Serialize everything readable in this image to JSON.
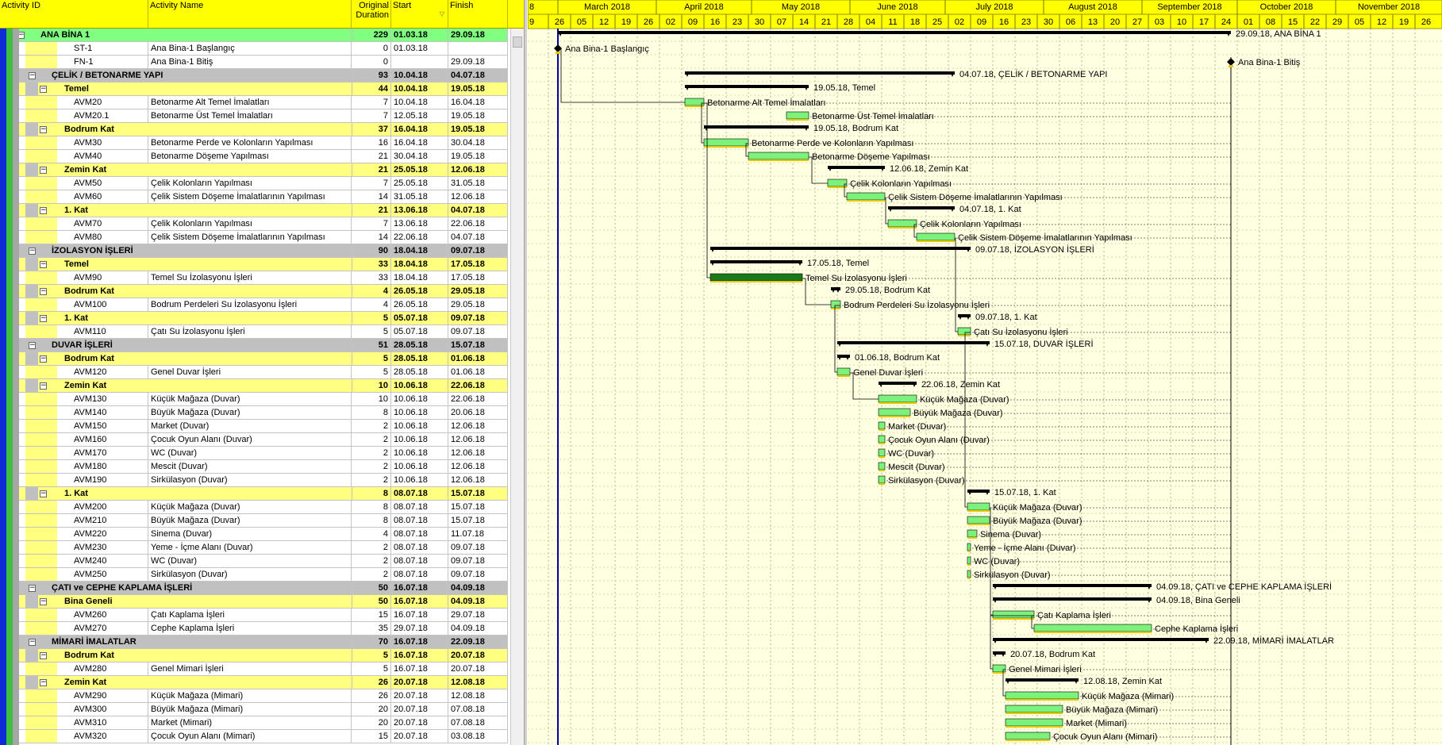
{
  "columns": {
    "activity_id": "Activity ID",
    "activity_name": "Activity Name",
    "duration_line1": "Original",
    "duration_line2": "Duration",
    "start": "Start",
    "finish": "Finish"
  },
  "timeline": {
    "months": [
      "8",
      "March 2018",
      "April 2018",
      "May 2018",
      "June 2018",
      "July 2018",
      "August 2018",
      "September 2018",
      "October 2018",
      "November 2018"
    ],
    "weeks": [
      "9",
      "26",
      "05",
      "12",
      "19",
      "26",
      "02",
      "09",
      "16",
      "23",
      "30",
      "07",
      "14",
      "21",
      "28",
      "04",
      "11",
      "18",
      "25",
      "02",
      "09",
      "16",
      "23",
      "30",
      "06",
      "13",
      "20",
      "27",
      "03",
      "10",
      "17",
      "24",
      "01",
      "08",
      "15",
      "22",
      "29",
      "05",
      "12",
      "19",
      "26"
    ]
  },
  "colors": {
    "row_level0": "#80ff80",
    "row_level1": "#c0c0c0",
    "row_level2": "#ffff80",
    "row_activity": "#ffffff",
    "chart_bg": "#ffffe1",
    "bar_fill": "#7cf27c",
    "bar_critical": "#1a7a1a",
    "summary_bar": "#000000",
    "header_yellow": "#ffff00",
    "data_date_line": "#0000a0"
  },
  "rows": [
    {
      "level": 0,
      "toggle": "−",
      "id": "ANA BİNA 1",
      "name": "",
      "duration": "229",
      "start": "01.03.18",
      "finish": "29.09.18"
    },
    {
      "level": 3,
      "toggle": "",
      "id": "ST-1",
      "name": "Ana Bina-1 Başlangıç",
      "duration": "0",
      "start": "01.03.18",
      "finish": ""
    },
    {
      "level": 3,
      "toggle": "",
      "id": "FN-1",
      "name": "Ana Bina-1 Bitiş",
      "duration": "0",
      "start": "",
      "finish": "29.09.18"
    },
    {
      "level": 1,
      "toggle": "−",
      "id": "ÇELİK / BETONARME YAPI",
      "name": "",
      "duration": "93",
      "start": "10.04.18",
      "finish": "04.07.18"
    },
    {
      "level": 2,
      "toggle": "−",
      "id": "Temel",
      "name": "",
      "duration": "44",
      "start": "10.04.18",
      "finish": "19.05.18"
    },
    {
      "level": 3,
      "toggle": "",
      "id": "AVM20",
      "name": "Betonarme Alt Temel İmalatları",
      "duration": "7",
      "start": "10.04.18",
      "finish": "16.04.18"
    },
    {
      "level": 3,
      "toggle": "",
      "id": "AVM20.1",
      "name": "Betonarme Üst Temel İmalatları",
      "duration": "7",
      "start": "12.05.18",
      "finish": "19.05.18"
    },
    {
      "level": 2,
      "toggle": "−",
      "id": "Bodrum Kat",
      "name": "",
      "duration": "37",
      "start": "16.04.18",
      "finish": "19.05.18"
    },
    {
      "level": 3,
      "toggle": "",
      "id": "AVM30",
      "name": "Betonarme Perde ve Kolonların Yapılması",
      "duration": "16",
      "start": "16.04.18",
      "finish": "30.04.18"
    },
    {
      "level": 3,
      "toggle": "",
      "id": "AVM40",
      "name": "Betonarme Döşeme Yapılması",
      "duration": "21",
      "start": "30.04.18",
      "finish": "19.05.18"
    },
    {
      "level": 2,
      "toggle": "−",
      "id": "Zemin Kat",
      "name": "",
      "duration": "21",
      "start": "25.05.18",
      "finish": "12.06.18"
    },
    {
      "level": 3,
      "toggle": "",
      "id": "AVM50",
      "name": "Çelik Kolonların Yapılması",
      "duration": "7",
      "start": "25.05.18",
      "finish": "31.05.18"
    },
    {
      "level": 3,
      "toggle": "",
      "id": "AVM60",
      "name": "Çelik Sistem Döşeme İmalatlarının Yapılması",
      "duration": "14",
      "start": "31.05.18",
      "finish": "12.06.18"
    },
    {
      "level": 2,
      "toggle": "−",
      "id": "1. Kat",
      "name": "",
      "duration": "21",
      "start": "13.06.18",
      "finish": "04.07.18"
    },
    {
      "level": 3,
      "toggle": "",
      "id": "AVM70",
      "name": "Çelik Kolonların Yapılması",
      "duration": "7",
      "start": "13.06.18",
      "finish": "22.06.18"
    },
    {
      "level": 3,
      "toggle": "",
      "id": "AVM80",
      "name": "Çelik Sistem Döşeme İmalatlarının Yapılması",
      "duration": "14",
      "start": "22.06.18",
      "finish": "04.07.18"
    },
    {
      "level": 1,
      "toggle": "−",
      "id": "İZOLASYON İŞLERİ",
      "name": "",
      "duration": "90",
      "start": "18.04.18",
      "finish": "09.07.18"
    },
    {
      "level": 2,
      "toggle": "−",
      "id": "Temel",
      "name": "",
      "duration": "33",
      "start": "18.04.18",
      "finish": "17.05.18"
    },
    {
      "level": 3,
      "toggle": "",
      "id": "AVM90",
      "name": "Temel Su İzolasyonu İşleri",
      "duration": "33",
      "start": "18.04.18",
      "finish": "17.05.18"
    },
    {
      "level": 2,
      "toggle": "−",
      "id": "Bodrum Kat",
      "name": "",
      "duration": "4",
      "start": "26.05.18",
      "finish": "29.05.18"
    },
    {
      "level": 3,
      "toggle": "",
      "id": "AVM100",
      "name": "Bodrum Perdeleri Su İzolasyonu İşleri",
      "duration": "4",
      "start": "26.05.18",
      "finish": "29.05.18"
    },
    {
      "level": 2,
      "toggle": "−",
      "id": "1. Kat",
      "name": "",
      "duration": "5",
      "start": "05.07.18",
      "finish": "09.07.18"
    },
    {
      "level": 3,
      "toggle": "",
      "id": "AVM110",
      "name": "Çatı Su İzolasyonu İşleri",
      "duration": "5",
      "start": "05.07.18",
      "finish": "09.07.18"
    },
    {
      "level": 1,
      "toggle": "−",
      "id": "DUVAR İŞLERİ",
      "name": "",
      "duration": "51",
      "start": "28.05.18",
      "finish": "15.07.18"
    },
    {
      "level": 2,
      "toggle": "−",
      "id": "Bodrum Kat",
      "name": "",
      "duration": "5",
      "start": "28.05.18",
      "finish": "01.06.18"
    },
    {
      "level": 3,
      "toggle": "",
      "id": "AVM120",
      "name": "Genel Duvar İşleri",
      "duration": "5",
      "start": "28.05.18",
      "finish": "01.06.18"
    },
    {
      "level": 2,
      "toggle": "−",
      "id": "Zemin Kat",
      "name": "",
      "duration": "10",
      "start": "10.06.18",
      "finish": "22.06.18"
    },
    {
      "level": 3,
      "toggle": "",
      "id": "AVM130",
      "name": "Küçük Mağaza (Duvar)",
      "duration": "10",
      "start": "10.06.18",
      "finish": "22.06.18"
    },
    {
      "level": 3,
      "toggle": "",
      "id": "AVM140",
      "name": "Büyük Mağaza (Duvar)",
      "duration": "8",
      "start": "10.06.18",
      "finish": "20.06.18"
    },
    {
      "level": 3,
      "toggle": "",
      "id": "AVM150",
      "name": "Market (Duvar)",
      "duration": "2",
      "start": "10.06.18",
      "finish": "12.06.18"
    },
    {
      "level": 3,
      "toggle": "",
      "id": "AVM160",
      "name": "Çocuk Oyun Alanı (Duvar)",
      "duration": "2",
      "start": "10.06.18",
      "finish": "12.06.18"
    },
    {
      "level": 3,
      "toggle": "",
      "id": "AVM170",
      "name": "WC (Duvar)",
      "duration": "2",
      "start": "10.06.18",
      "finish": "12.06.18"
    },
    {
      "level": 3,
      "toggle": "",
      "id": "AVM180",
      "name": "Mescit (Duvar)",
      "duration": "2",
      "start": "10.06.18",
      "finish": "12.06.18"
    },
    {
      "level": 3,
      "toggle": "",
      "id": "AVM190",
      "name": "Sirkülasyon (Duvar)",
      "duration": "2",
      "start": "10.06.18",
      "finish": "12.06.18"
    },
    {
      "level": 2,
      "toggle": "−",
      "id": "1. Kat",
      "name": "",
      "duration": "8",
      "start": "08.07.18",
      "finish": "15.07.18"
    },
    {
      "level": 3,
      "toggle": "",
      "id": "AVM200",
      "name": "Küçük Mağaza (Duvar)",
      "duration": "8",
      "start": "08.07.18",
      "finish": "15.07.18"
    },
    {
      "level": 3,
      "toggle": "",
      "id": "AVM210",
      "name": "Büyük Mağaza (Duvar)",
      "duration": "8",
      "start": "08.07.18",
      "finish": "15.07.18"
    },
    {
      "level": 3,
      "toggle": "",
      "id": "AVM220",
      "name": "Sinema (Duvar)",
      "duration": "4",
      "start": "08.07.18",
      "finish": "11.07.18"
    },
    {
      "level": 3,
      "toggle": "",
      "id": "AVM230",
      "name": "Yeme - İçme Alanı (Duvar)",
      "duration": "2",
      "start": "08.07.18",
      "finish": "09.07.18"
    },
    {
      "level": 3,
      "toggle": "",
      "id": "AVM240",
      "name": "WC (Duvar)",
      "duration": "2",
      "start": "08.07.18",
      "finish": "09.07.18"
    },
    {
      "level": 3,
      "toggle": "",
      "id": "AVM250",
      "name": "Sirkülasyon (Duvar)",
      "duration": "2",
      "start": "08.07.18",
      "finish": "09.07.18"
    },
    {
      "level": 1,
      "toggle": "−",
      "id": "ÇATI ve CEPHE KAPLAMA İŞLERİ",
      "name": "",
      "duration": "50",
      "start": "16.07.18",
      "finish": "04.09.18"
    },
    {
      "level": 2,
      "toggle": "−",
      "id": "Bina Geneli",
      "name": "",
      "duration": "50",
      "start": "16.07.18",
      "finish": "04.09.18"
    },
    {
      "level": 3,
      "toggle": "",
      "id": "AVM260",
      "name": "Çatı Kaplama İşleri",
      "duration": "15",
      "start": "16.07.18",
      "finish": "29.07.18"
    },
    {
      "level": 3,
      "toggle": "",
      "id": "AVM270",
      "name": "Cephe Kaplama İşleri",
      "duration": "35",
      "start": "29.07.18",
      "finish": "04.09.18"
    },
    {
      "level": 1,
      "toggle": "−",
      "id": "MİMARİ İMALATLAR",
      "name": "",
      "duration": "70",
      "start": "16.07.18",
      "finish": "22.09.18"
    },
    {
      "level": 2,
      "toggle": "−",
      "id": "Bodrum Kat",
      "name": "",
      "duration": "5",
      "start": "16.07.18",
      "finish": "20.07.18"
    },
    {
      "level": 3,
      "toggle": "",
      "id": "AVM280",
      "name": "Genel Mimari İşleri",
      "duration": "5",
      "start": "16.07.18",
      "finish": "20.07.18"
    },
    {
      "level": 2,
      "toggle": "−",
      "id": "Zemin Kat",
      "name": "",
      "duration": "26",
      "start": "20.07.18",
      "finish": "12.08.18"
    },
    {
      "level": 3,
      "toggle": "",
      "id": "AVM290",
      "name": "Küçük Mağaza (Mimari)",
      "duration": "26",
      "start": "20.07.18",
      "finish": "12.08.18"
    },
    {
      "level": 3,
      "toggle": "",
      "id": "AVM300",
      "name": "Büyük Mağaza (Mimari)",
      "duration": "20",
      "start": "20.07.18",
      "finish": "07.08.18"
    },
    {
      "level": 3,
      "toggle": "",
      "id": "AVM310",
      "name": "Market (Mimari)",
      "duration": "20",
      "start": "20.07.18",
      "finish": "07.08.18"
    },
    {
      "level": 3,
      "toggle": "",
      "id": "AVM320",
      "name": "Çocuk Oyun Alanı (Mimari)",
      "duration": "15",
      "start": "20.07.18",
      "finish": "03.08.18"
    }
  ],
  "bar_labels": [
    "29.09.18, ANA BİNA 1",
    "Ana Bina-1 Başlangıç",
    "Ana Bina-1 Bitiş",
    "04.07.18, ÇELİK / BETONARME YAPI",
    "19.05.18, Temel",
    "Betonarme Alt Temel İmalatları",
    "Betonarme Üst Temel İmalatları",
    "19.05.18, Bodrum Kat",
    "Betonarme Perde ve Kolonların Yapılması",
    "Betonarme Döşeme Yapılması",
    "12.06.18, Zemin Kat",
    "Çelik Kolonların Yapılması",
    "Çelik Sistem Döşeme İmalatlarının Yapılması",
    "04.07.18, 1. Kat",
    "Çelik Kolonların Yapılması",
    "Çelik Sistem Döşeme İmalatlarının Yapılması",
    "09.07.18, İZOLASYON İŞLERİ",
    "17.05.18, Temel",
    "Temel Su İzolasyonu İşleri",
    "29.05.18, Bodrum Kat",
    "Bodrum Perdeleri Su İzolasyonu İşleri",
    "09.07.18, 1. Kat",
    "Çatı Su İzolasyonu İşleri",
    "15.07.18, DUVAR İŞLERİ",
    "01.06.18, Bodrum Kat",
    "Genel Duvar İşleri",
    "22.06.18, Zemin Kat",
    "Küçük Mağaza (Duvar)",
    "Büyük Mağaza (Duvar)",
    "Market (Duvar)",
    "Çocuk Oyun Alanı (Duvar)",
    "WC (Duvar)",
    "Mescit (Duvar)",
    "Sirkülasyon (Duvar)",
    "15.07.18, 1. Kat",
    "Küçük Mağaza (Duvar)",
    "Büyük Mağaza (Duvar)",
    "Sinema (Duvar)",
    "Yeme - İçme Alanı (Duvar)",
    "WC (Duvar)",
    "Sirkülasyon (Duvar)",
    "04.09.18, ÇATI ve CEPHE KAPLAMA İŞLERİ",
    "04.09.18, Bina Geneli",
    "Çatı Kaplama İşleri",
    "Cephe Kaplama İşleri",
    "22.09.18, MİMARİ İMALATLAR",
    "20.07.18, Bodrum Kat",
    "Genel Mimari İşleri",
    "12.08.18, Zemin Kat",
    "Küçük Mağaza (Mimari)",
    "Büyük Mağaza (Mimari)",
    "Market (Mimari)",
    "Çocuk Oyun Alanı (Mimari)"
  ]
}
